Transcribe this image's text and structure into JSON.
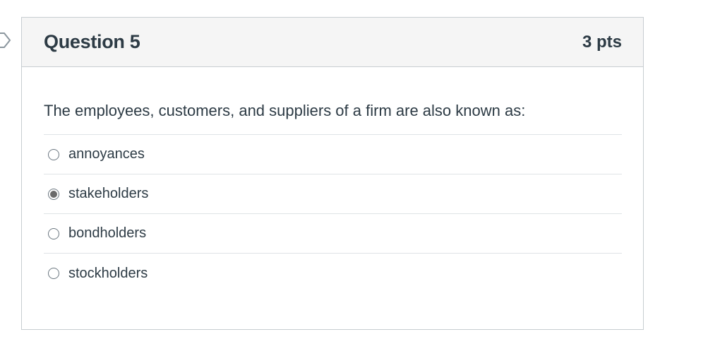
{
  "question": {
    "title": "Question 5",
    "points": "3 pts",
    "text": "The employees, customers, and suppliers of a firm are also known as:"
  },
  "answers": [
    {
      "label": "annoyances",
      "selected": false
    },
    {
      "label": "stakeholders",
      "selected": true
    },
    {
      "label": "bondholders",
      "selected": false
    },
    {
      "label": "stockholders",
      "selected": false
    }
  ],
  "icons": {
    "flag": "question-flag-icon"
  },
  "colors": {
    "header_bg": "#f5f5f5",
    "border": "#c7cdd1",
    "text": "#2d3b45",
    "selected_dot": "#6b6b6b"
  }
}
